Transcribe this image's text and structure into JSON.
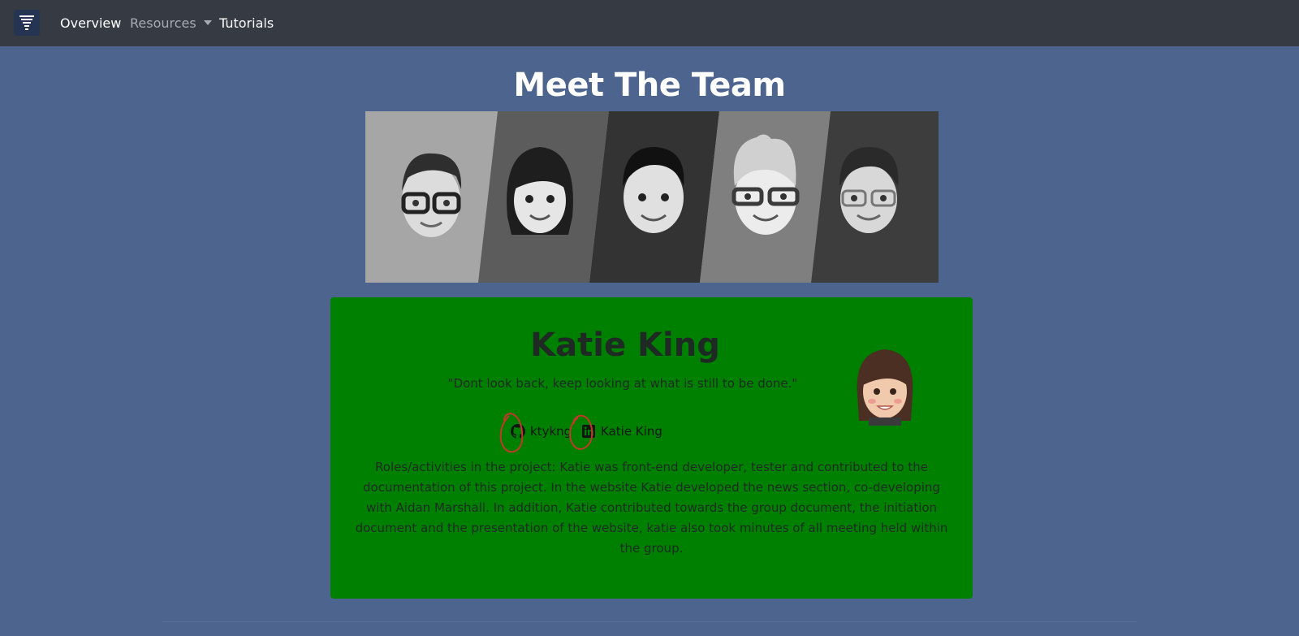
{
  "navbar": {
    "logo_icon": "menu-lines-icon",
    "items": [
      {
        "label": "Overview"
      },
      {
        "label": "Resources"
      },
      {
        "label": "Tutorials"
      }
    ]
  },
  "page": {
    "title": "Meet The Team",
    "banner_icon": "team-memoji-banner"
  },
  "member": {
    "name": "Katie King",
    "quote": "\"Dont look back, keep looking at what is still to be done.\"",
    "avatar_icon": "memoji-avatar",
    "github": {
      "icon": "github-icon",
      "handle": "ktykng"
    },
    "linkedin": {
      "icon": "linkedin-icon",
      "name": "Katie King"
    },
    "roles": "Roles/activities in the project: Katie was front-end developer, tester and contributed to the documentation of this project. In the website Katie developed the news section, co-developing with Aidan Marshall. In addition, Katie contributed towards the group document, the initiation document and the presentation of the website, katie also took minutes of all meeting held within the group."
  },
  "colors": {
    "background": "#4d648f",
    "navbar": "#353a43",
    "card": "#008000",
    "annotation": "#c0392b"
  }
}
